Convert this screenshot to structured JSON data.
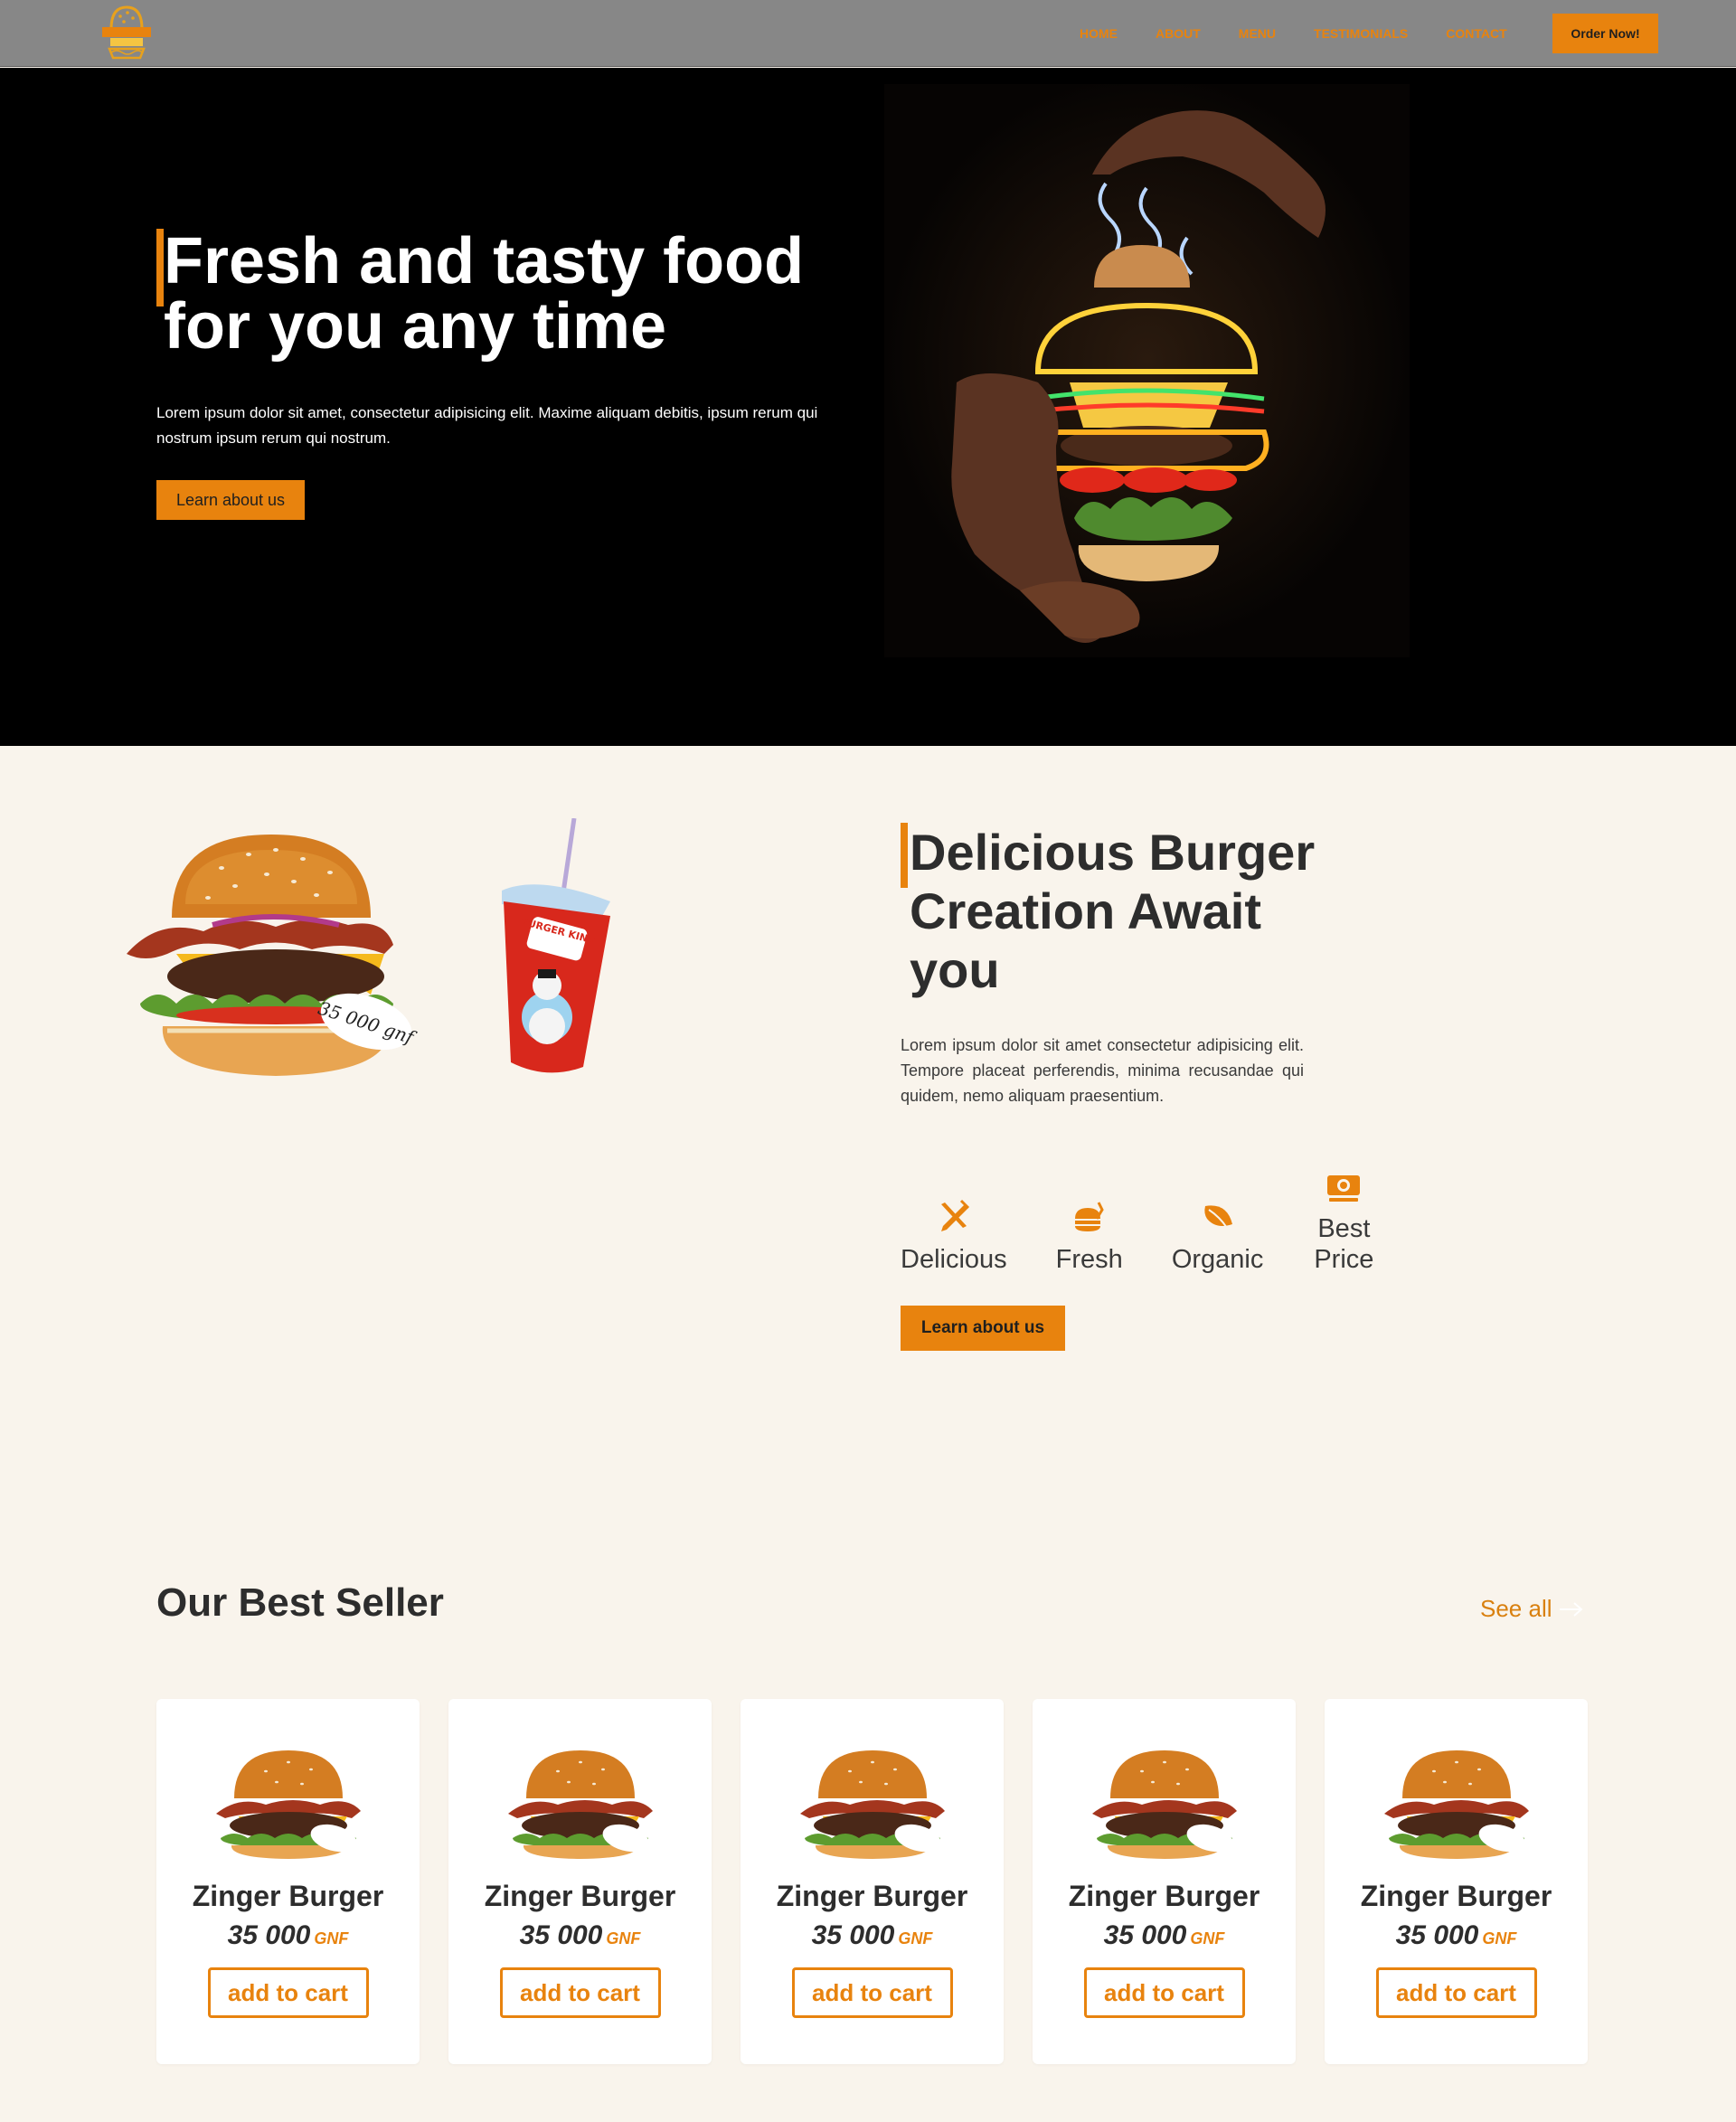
{
  "nav": {
    "logo_alt": "Burger King",
    "links": [
      "HOME",
      "ABOUT",
      "MENU",
      "TESTIMONIALS",
      "CONTACT"
    ],
    "order_label": "Order Now!"
  },
  "hero": {
    "title_line1": "Fresh and tasty food",
    "title_line2": "for you any time",
    "description": "Lorem ipsum dolor sit amet, consectetur adipisicing elit. Maxime aliquam debitis, ipsum rerum qui nostrum ipsum rerum qui nostrum.",
    "button_label": "Learn about us"
  },
  "about": {
    "title": "Delicious Burger Creation Await you",
    "description": "Lorem ipsum dolor sit amet consectetur adipisicing elit. Tempore placeat perferendis, minima recusandae qui quidem, nemo aliquam praesentium.",
    "price_tag": "35 000 gnf",
    "cup_brand": "BURGER KING",
    "features": [
      {
        "label": "Delicious",
        "icon": "utensils-icon"
      },
      {
        "label": "Fresh",
        "icon": "fresh-food-icon"
      },
      {
        "label": "Organic",
        "icon": "leaf-icon"
      },
      {
        "label": "Best Price",
        "icon": "money-icon"
      }
    ],
    "button_label": "Learn about us"
  },
  "bestseller": {
    "title": "Our Best Seller",
    "see_all": "See all",
    "items": [
      {
        "name": "Zinger Burger",
        "price": "35 000",
        "currency": "GNF",
        "button": "add to cart"
      },
      {
        "name": "Zinger Burger",
        "price": "35 000",
        "currency": "GNF",
        "button": "add to cart"
      },
      {
        "name": "Zinger Burger",
        "price": "35 000",
        "currency": "GNF",
        "button": "add to cart"
      },
      {
        "name": "Zinger Burger",
        "price": "35 000",
        "currency": "GNF",
        "button": "add to cart"
      },
      {
        "name": "Zinger Burger",
        "price": "35 000",
        "currency": "GNF",
        "button": "add to cart"
      }
    ]
  },
  "colors": {
    "accent": "#e8830e",
    "nav_bg": "#878787",
    "hero_bg": "#000000",
    "page_bg": "#f9f4ec",
    "text_dark": "#2d2d2d"
  }
}
